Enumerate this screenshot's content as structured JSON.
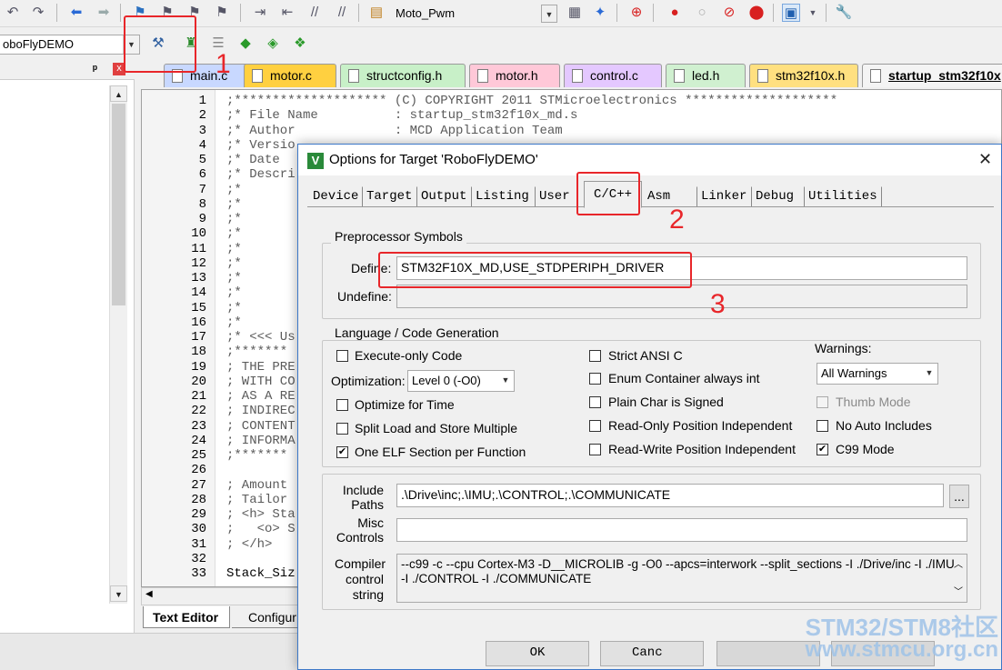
{
  "toolbar": {
    "target_combo": "Moto_Pwm",
    "project_combo": "oboFlyDEMO"
  },
  "left_panel": {
    "pin": "ᵖ",
    "close": "x"
  },
  "file_tabs": [
    {
      "label": "main.c",
      "color": "#c8d8ff"
    },
    {
      "label": "motor.c",
      "color": "#ffd040"
    },
    {
      "label": "structconfig.h",
      "color": "#c8f0c8"
    },
    {
      "label": "motor.h",
      "color": "#ffc8d8"
    },
    {
      "label": "control.c",
      "color": "#e4c8ff"
    },
    {
      "label": "led.h",
      "color": "#d0f0d0"
    },
    {
      "label": "stm32f10x.h",
      "color": "#ffe080"
    },
    {
      "label": "startup_stm32f10x",
      "color": "#f4f4f4"
    }
  ],
  "editor": {
    "line_numbers": [
      "1",
      "2",
      "3",
      "4",
      "5",
      "6",
      "7",
      "8",
      "9",
      "10",
      "11",
      "12",
      "13",
      "14",
      "15",
      "16",
      "17",
      "18",
      "19",
      "20",
      "21",
      "22",
      "23",
      "24",
      "25",
      "26",
      "27",
      "28",
      "29",
      "30",
      "31",
      "32",
      "33"
    ],
    "lines": [
      ";******************** (C) COPYRIGHT 2011 STMicroelectronics ********************",
      ";* File Name          : startup_stm32f10x_md.s",
      ";* Author             : MCD Application Team",
      ";* Versio",
      ";* Date",
      ";* Descri",
      ";*",
      ";*",
      ";*",
      ";*",
      ";*",
      ";*",
      ";*",
      ";*",
      ";*",
      ";*",
      ";* <<< Us",
      ";*******",
      "; THE PRE",
      "; WITH CO",
      "; AS A RE",
      "; INDIREC",
      "; CONTENT",
      "; INFORMA",
      ";*******",
      "",
      "; Amount",
      "; Tailor",
      "; <h> Sta",
      ";   <o> S",
      "; </h>",
      "",
      "Stack_Siz"
    ]
  },
  "bottom_tabs": {
    "text_editor": "Text Editor",
    "configuration": "Configur"
  },
  "dialog": {
    "title": "Options for Target 'RoboFlyDEMO'",
    "close": "✕",
    "tabs": [
      "Device",
      "Target",
      "Output",
      "Listing",
      "User",
      "C/C++",
      "Asm",
      "Linker",
      "Debug",
      "Utilities"
    ],
    "active_tab": "C/C++",
    "preprocessor": {
      "group_title": "Preprocessor Symbols",
      "define_label": "Define:",
      "define_value": "STM32F10X_MD,USE_STDPERIPH_DRIVER",
      "undefine_label": "Undefine:",
      "undefine_value": ""
    },
    "language": {
      "group_title": "Language / Code Generation",
      "execute_only": "Execute-only Code",
      "optimization_label": "Optimization:",
      "optimization_value": "Level 0 (-O0)",
      "optimize_time": "Optimize for Time",
      "split_load": "Split Load and Store Multiple",
      "one_elf": "One ELF Section per Function",
      "strict_ansi": "Strict ANSI C",
      "enum_container": "Enum Container always int",
      "plain_char": "Plain Char is Signed",
      "ro_pos": "Read-Only Position Independent",
      "rw_pos": "Read-Write Position Independent",
      "warnings_label": "Warnings:",
      "warnings_value": "All Warnings",
      "thumb_mode": "Thumb Mode",
      "no_auto": "No Auto Includes",
      "c99": "C99 Mode"
    },
    "include_label_1": "Include",
    "include_label_2": "Paths",
    "include_value": ".\\Drive\\inc;.\\IMU;.\\CONTROL;.\\COMMUNICATE",
    "browse": "...",
    "misc_label_1": "Misc",
    "misc_label_2": "Controls",
    "misc_value": "",
    "compiler_label_1": "Compiler",
    "compiler_label_2": "control",
    "compiler_label_3": "string",
    "compiler_line1": "--c99 -c --cpu Cortex-M3 -D__MICROLIB -g -O0 --apcs=interwork --split_sections -I ./Drive/inc -I ./IMU",
    "compiler_line2": "-I ./CONTROL -I ./COMMUNICATE",
    "ok": "OK",
    "cancel": "Canc"
  },
  "annotations": {
    "n1": "1",
    "n2": "2",
    "n3": "3",
    "color": "#e8262a"
  },
  "watermark": {
    "line1": "STM32/STM8社区",
    "line2": "www.stmcu.org.cn"
  }
}
